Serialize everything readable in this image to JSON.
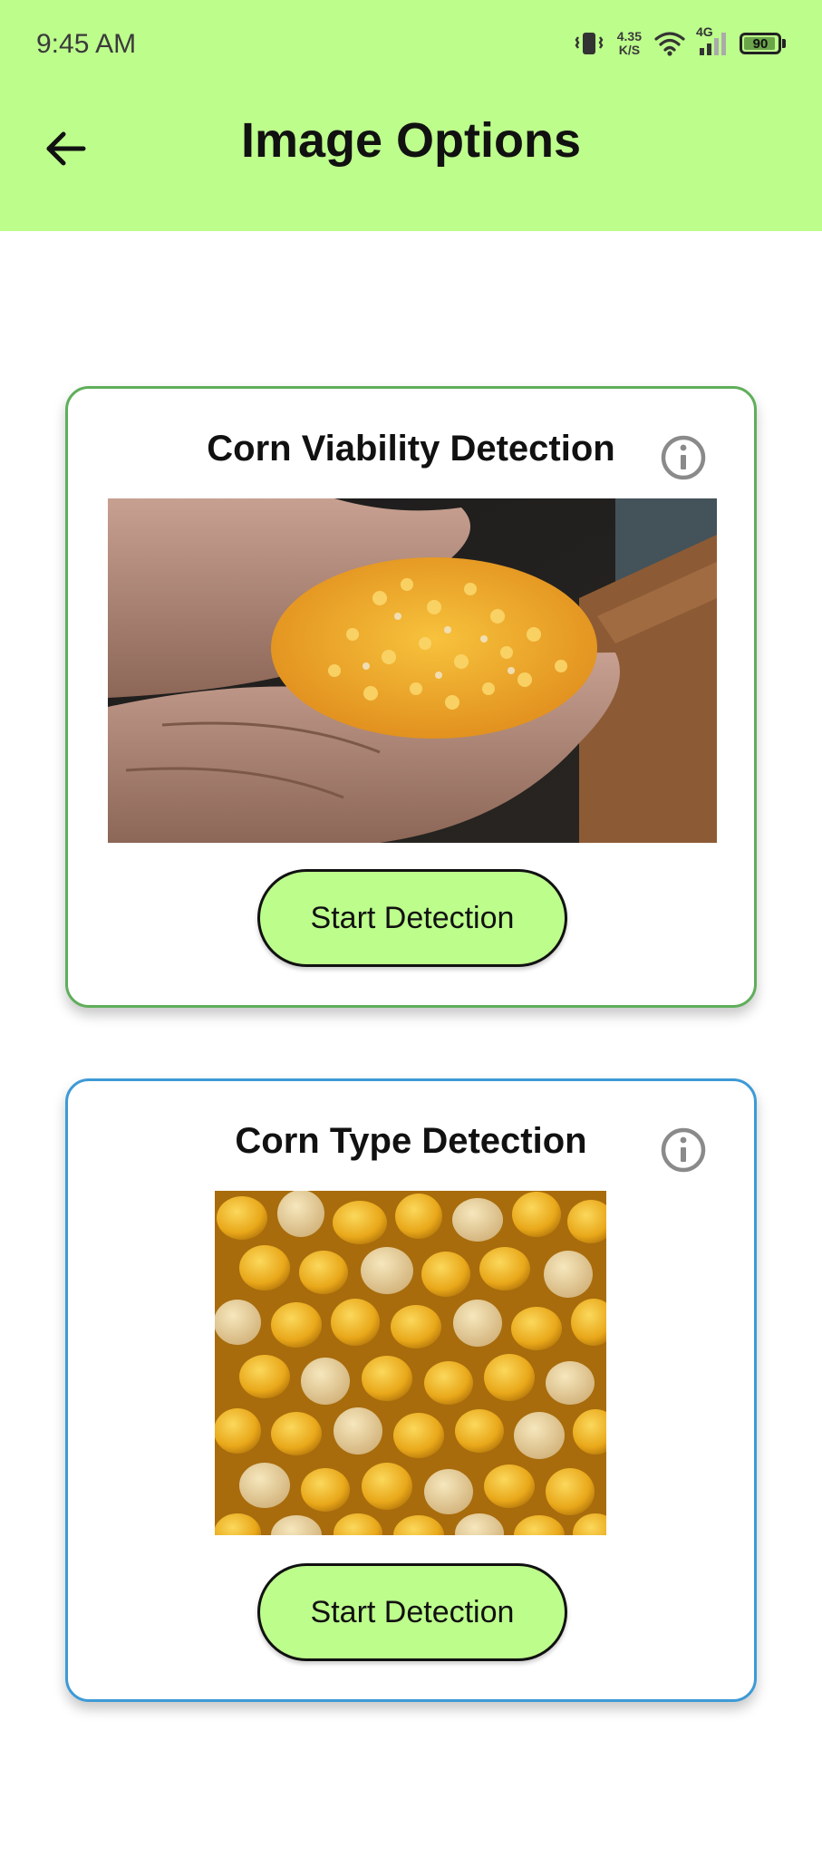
{
  "status_bar": {
    "time": "9:45 AM",
    "net_speed_value": "4.35",
    "net_speed_unit": "K/S",
    "network_type": "4G",
    "battery_level": "90",
    "icons": [
      "vibrate-icon",
      "wifi-icon",
      "signal-icon",
      "battery-icon"
    ]
  },
  "header": {
    "title": "Image Options",
    "back_icon": "arrow-left-icon",
    "background": "#bdfd8c"
  },
  "cards": [
    {
      "title": "Corn Viability Detection",
      "info_icon": "info-icon",
      "image": "hands holding corn kernels",
      "button_label": "Start Detection",
      "border_color": "#5fae5a"
    },
    {
      "title": "Corn Type Detection",
      "info_icon": "info-icon",
      "image": "close-up of corn kernels",
      "button_label": "Start Detection",
      "border_color": "#3d9ad6"
    }
  ],
  "colors": {
    "accent": "#bdfd8c",
    "text": "#111111"
  }
}
